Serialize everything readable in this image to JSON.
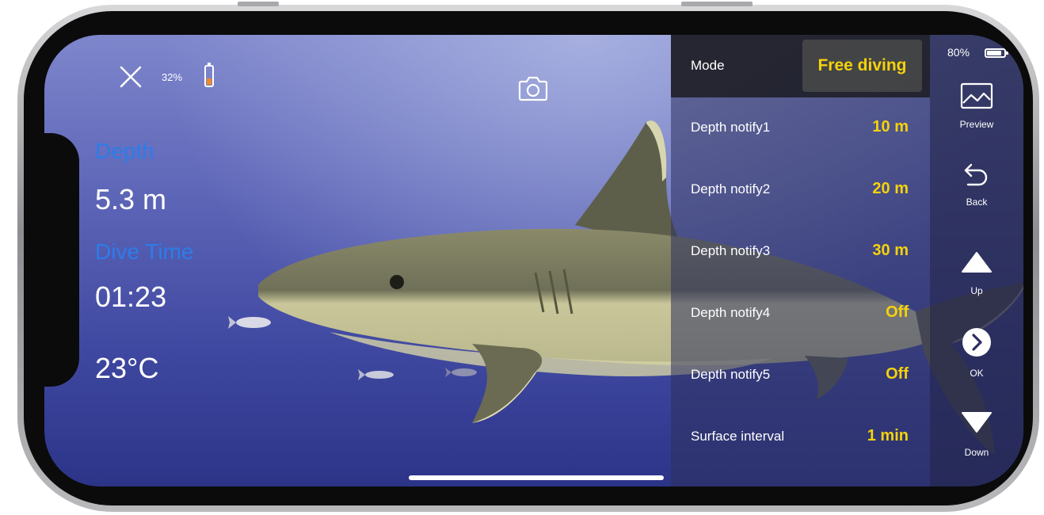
{
  "camera_overlay": {
    "close_icon": "close-icon",
    "battery_percent": "32%",
    "battery_icon": "battery-icon",
    "battery_color": "#f28a21",
    "camera_icon": "camera-icon"
  },
  "readouts": {
    "depth_label": "Depth",
    "depth_value": "5.3 m",
    "dive_time_label": "Dive Time",
    "dive_time_value": "01:23",
    "temperature_value": "23°C",
    "label_color": "#2b7de9"
  },
  "settings": {
    "mode_label": "Mode",
    "mode_value": "Free diving",
    "value_color": "#f5d20b",
    "rows": [
      {
        "label": "Depth notify1",
        "value": "10 m"
      },
      {
        "label": "Depth notify2",
        "value": "20 m"
      },
      {
        "label": "Depth notify3",
        "value": "30 m"
      },
      {
        "label": "Depth notify4",
        "value": "Off"
      },
      {
        "label": "Depth notify5",
        "value": "Off"
      },
      {
        "label": "Surface interval",
        "value": "1 min"
      }
    ]
  },
  "nav": {
    "battery_percent": "80%",
    "buttons": [
      {
        "label": "Preview",
        "icon": "image-icon"
      },
      {
        "label": "Back",
        "icon": "back-arrow-icon"
      },
      {
        "label": "Up",
        "icon": "triangle-up-icon"
      },
      {
        "label": "OK",
        "icon": "chevron-right-circle-icon"
      },
      {
        "label": "Down",
        "icon": "triangle-down-icon"
      }
    ]
  }
}
